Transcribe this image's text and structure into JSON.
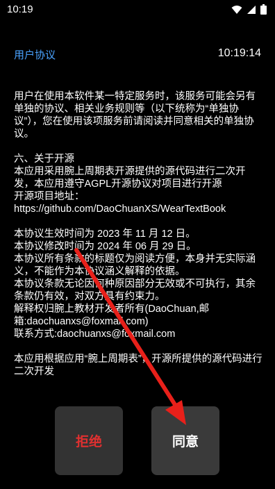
{
  "status_bar": {
    "time": "10:19",
    "icons": [
      "wifi-icon",
      "signal-icon",
      "battery-icon"
    ]
  },
  "header": {
    "title": "用户协议",
    "clock": "10:19:14"
  },
  "content": {
    "paragraphs": [
      "用户在使用本软件某一特定服务时，该服务可能会另有单独的协议、相关业务规则等（以下统称为“单独协议”），您在使用该项服务前请阅读并同意相关的单独协议。",
      "六、关于开源\n本应用采用腕上周期表开源提供的源代码进行二次开发，本应用遵守AGPL开源协议对项目进行开源\n开源项目地址：https://github.com/DaoChuanXS/WearTextBook",
      "本协议生效时间为 2023 年 11 月 12 日。\n本协议修改时间为 2024 年 06 月 29 日。\n本协议所有条款的标题仅为阅读方便，本身并无实际涵义，不能作为本协议涵义解释的依据。\n本协议条款无论因何种原因部分无效或不可执行，其余条款仍有效，对双方具有约束力。\n解释权归腕上教材开发者所有(DaoChuan,邮箱:daochuanxs@foxmail.com)\n联系方式:daochuanxs@foxmail.com",
      "本应用根据应用“腕上周期表”，开源所提供的源代码进行二次开发"
    ]
  },
  "buttons": {
    "reject_label": "拒绝",
    "accept_label": "同意"
  },
  "colors": {
    "background": "#000000",
    "title_blue": "#4aa3ff",
    "reject_red": "#e03030",
    "button_bg": "#333333",
    "arrow_red": "#e8201a"
  }
}
